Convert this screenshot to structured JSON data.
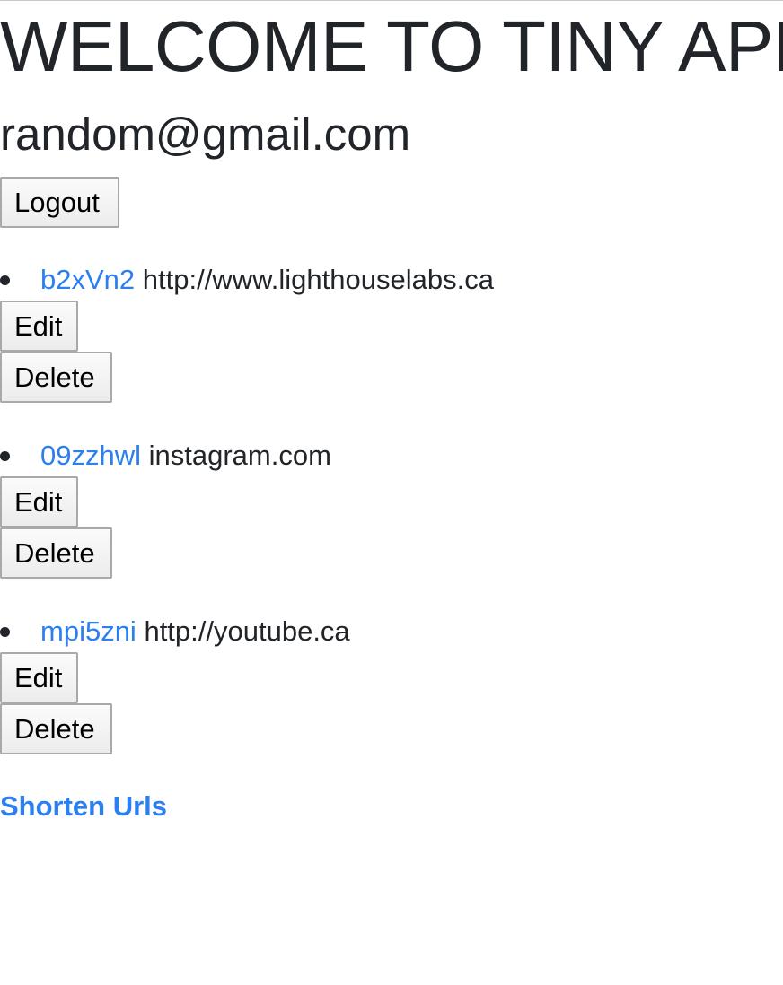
{
  "header": {
    "title": "WELCOME TO TINY APP",
    "email": "random@gmail.com",
    "logout_label": "Logout"
  },
  "urls": [
    {
      "short_id": "b2xVn2",
      "long_url": "http://www.lighthouselabs.ca",
      "edit_label": "Edit",
      "delete_label": "Delete"
    },
    {
      "short_id": "09zzhwl",
      "long_url": "instagram.com",
      "edit_label": "Edit",
      "delete_label": "Delete"
    },
    {
      "short_id": "mpi5zni",
      "long_url": "http://youtube.ca",
      "edit_label": "Edit",
      "delete_label": "Delete"
    }
  ],
  "footer": {
    "shorten_label": "Shorten Urls"
  },
  "colors": {
    "link": "#2b7ff0",
    "text": "#212529"
  }
}
